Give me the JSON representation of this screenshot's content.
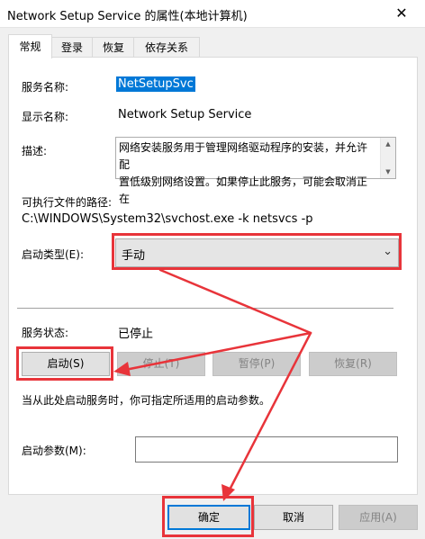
{
  "window": {
    "title": "Network Setup Service 的属性(本地计算机)"
  },
  "tabs": [
    {
      "label": "常规"
    },
    {
      "label": "登录"
    },
    {
      "label": "恢复"
    },
    {
      "label": "依存关系"
    }
  ],
  "general": {
    "service_name_label": "服务名称:",
    "service_name_value": "NetSetupSvc",
    "display_name_label": "显示名称:",
    "display_name_value": "Network Setup Service",
    "description_label": "描述:",
    "description_line1": "网络安装服务用于管理网络驱动程序的安装，并允许配",
    "description_line2": "置低级别网络设置。如果停止此服务，可能会取消正在",
    "exe_path_label": "可执行文件的路径:",
    "exe_path_value": "C:\\WINDOWS\\System32\\svchost.exe -k netsvcs -p",
    "startup_type_label": "启动类型(E):",
    "startup_type_value": "手动",
    "status_label": "服务状态:",
    "status_value": "已停止",
    "start_button": "启动(S)",
    "stop_button": "停止(T)",
    "pause_button": "暂停(P)",
    "resume_button": "恢复(R)",
    "hint_text": "当从此处启动服务时，你可指定所适用的启动参数。",
    "params_label": "启动参数(M):",
    "params_value": ""
  },
  "footer": {
    "ok_button": "确定",
    "cancel_button": "取消",
    "apply_button": "应用(A)"
  },
  "colors": {
    "accent": "#0078d7",
    "annotation_red": "#e8343a"
  },
  "icons": {
    "close": "close-icon",
    "dropdown": "chevron-down-icon",
    "scroll_up": "scroll-up-icon",
    "scroll_down": "scroll-down-icon"
  }
}
